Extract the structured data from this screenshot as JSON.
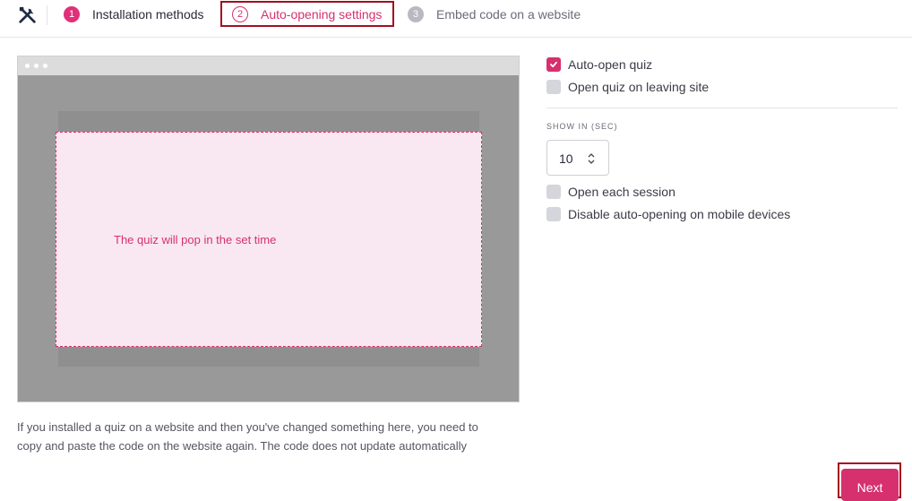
{
  "header": {
    "tools_icon": "tools-icon",
    "steps": [
      {
        "num": "1",
        "label": "Installation methods"
      },
      {
        "num": "2",
        "label": "Auto-opening settings"
      },
      {
        "num": "3",
        "label": "Embed code on a website"
      }
    ]
  },
  "preview": {
    "message": "The quiz will pop in the set time"
  },
  "note": {
    "line1": "If you installed a quiz on a website and then you've changed something here, you need to",
    "line2": "copy and paste the code on the website again. The code does not update automatically"
  },
  "settings": {
    "auto_open": {
      "label": "Auto-open quiz",
      "checked": true
    },
    "on_leaving": {
      "label": "Open quiz on leaving site",
      "checked": false
    },
    "show_in_label": "SHOW IN (SEC)",
    "show_in_value": "10",
    "each_session": {
      "label": "Open each session",
      "checked": false
    },
    "disable_mobile": {
      "label": "Disable auto-opening on mobile devices",
      "checked": false
    }
  },
  "footer": {
    "next_label": "Next"
  },
  "colors": {
    "accent": "#d6306f",
    "highlight_border": "#a10f1e"
  }
}
